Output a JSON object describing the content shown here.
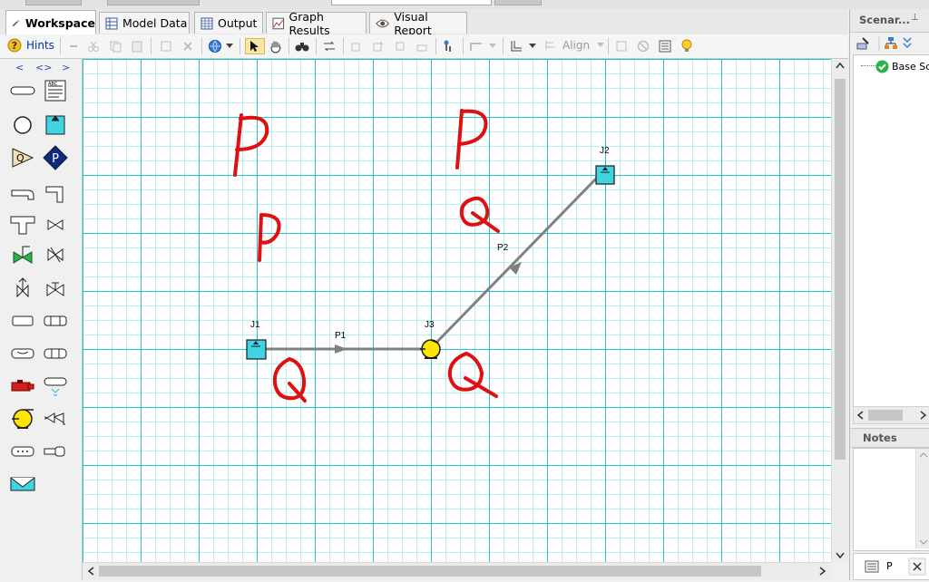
{
  "tabs": [
    {
      "label": "Workspace",
      "active": true
    },
    {
      "label": "Model Data",
      "active": false
    },
    {
      "label": "Output",
      "active": false
    },
    {
      "label": "Graph Results",
      "active": false
    },
    {
      "label": "Visual Report",
      "active": false
    }
  ],
  "toolbar": {
    "hints_label": "Hints",
    "align_label": "Align"
  },
  "palette_nav": [
    "<",
    "<>",
    ">"
  ],
  "model": {
    "nodes": [
      {
        "id": "J1",
        "type": "reservoir"
      },
      {
        "id": "J2",
        "type": "reservoir"
      },
      {
        "id": "J3",
        "type": "pump"
      }
    ],
    "pipes": [
      {
        "id": "P1",
        "from": "J1",
        "to": "J3"
      },
      {
        "id": "P2",
        "from": "J3",
        "to": "J2"
      }
    ],
    "annotations": [
      "P",
      "P",
      "P",
      "Q",
      "Q",
      "Q"
    ]
  },
  "scenario_panel": {
    "title": "Scenar...",
    "pin": "⊥",
    "tree_item": "Base Sc"
  },
  "notes_panel": {
    "title": "Notes"
  },
  "bottom_right_tab": "P",
  "colors": {
    "grid_major": "#29c0d8",
    "grid_minor": "#b8eef5",
    "reservoir_fill": "#3fd4e4",
    "pump_fill": "#ffe600",
    "pipe": "#808080",
    "handwriting": "#e01010"
  }
}
